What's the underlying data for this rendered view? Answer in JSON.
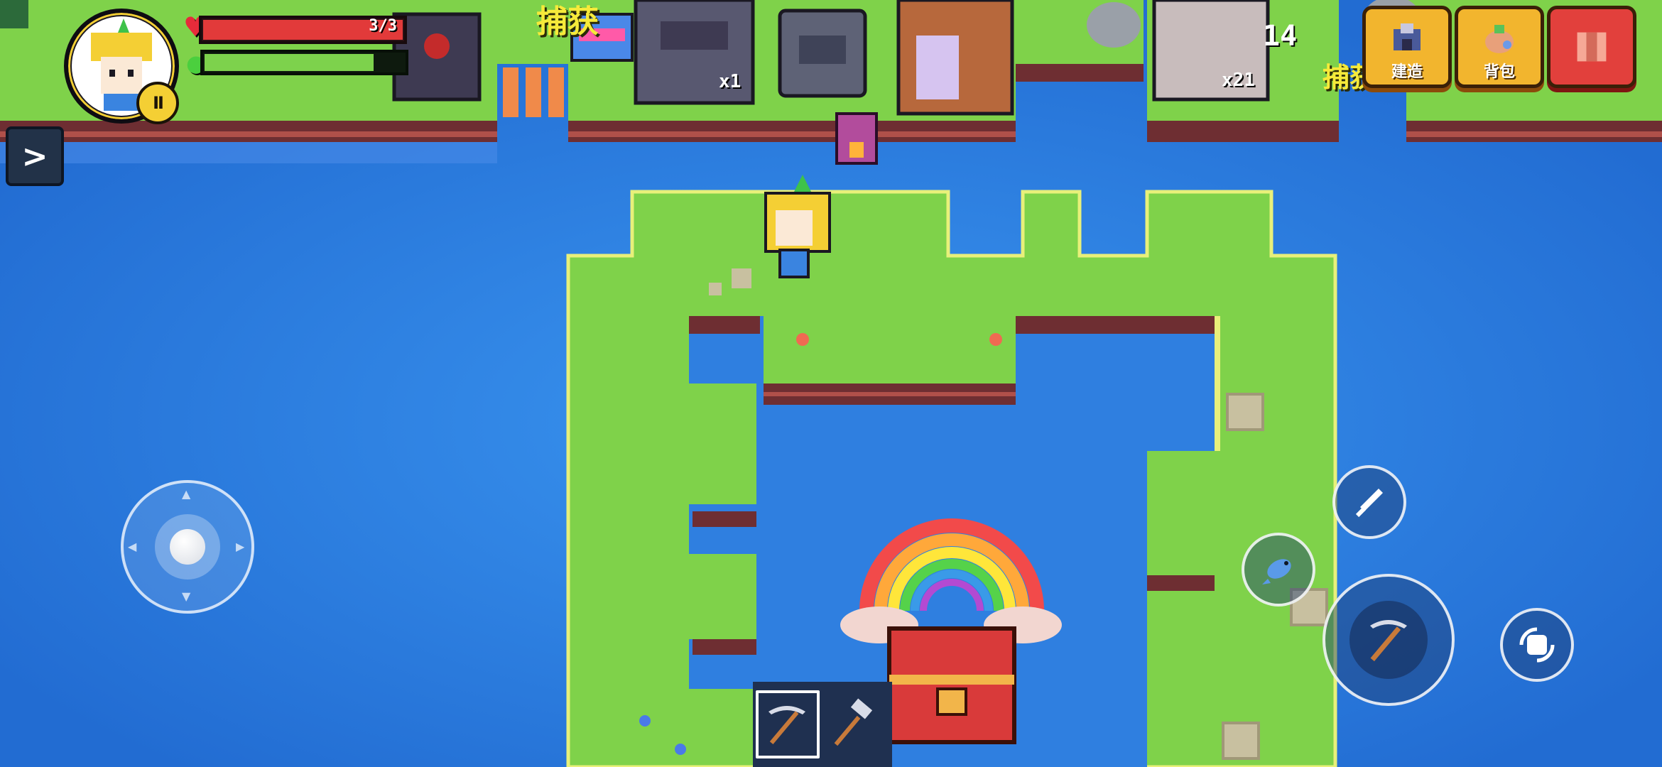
{
  "hud": {
    "health_text": "3/3",
    "health_fraction": 1.0,
    "energy_fraction": 0.85,
    "pause_label": "II",
    "side_toggle": ">"
  },
  "world": {
    "capture_label_left": "捕获",
    "capture_label_right": "捕获",
    "count_left": "x1",
    "count_right": "x21",
    "count_top": "14"
  },
  "menu": {
    "build_label": "建造",
    "bag_label": "背包"
  },
  "hotbar": {
    "items": [
      "pickaxe",
      "hammer"
    ],
    "selected_index": 0
  },
  "colors": {
    "water": "#2f7fe0",
    "grass": "#7fd24a",
    "grass_edge": "#e8f07a",
    "cliff": "#7b3b3b"
  }
}
